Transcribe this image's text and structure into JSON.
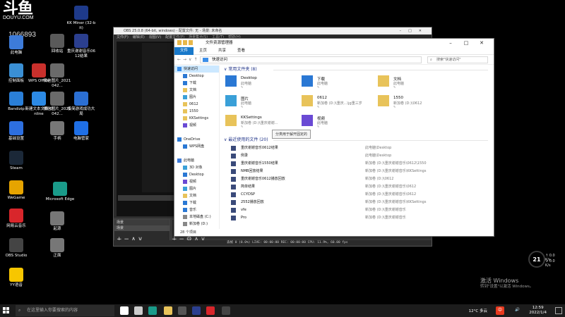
{
  "watermark": {
    "logo": "斗鱼",
    "site": "DOUYU.COM",
    "room": "1066893"
  },
  "desktop_icons": [
    {
      "label": "此电脑",
      "color": "#3d7bd9"
    },
    {
      "label": "控制面板",
      "color": "#3a8fd4"
    },
    {
      "label": "Bandizip",
      "color": "#2a7fd8"
    },
    {
      "label": "基础设置",
      "color": "#2d6fe0"
    },
    {
      "label": "Steam",
      "color": "#1b2838"
    },
    {
      "label": "WeGame",
      "color": "#e6a400"
    },
    {
      "label": "网易云音乐",
      "color": "#d8262b"
    },
    {
      "label": "OBS Studio",
      "color": "#444444"
    },
    {
      "label": "YY语音",
      "color": "#f7c600"
    },
    {
      "label": "WPS Office",
      "color": "#c9302c"
    },
    {
      "label": "新建文本文档 Online",
      "color": "#2c8ae5"
    },
    {
      "label": "回收站",
      "color": "#5a5a5a"
    },
    {
      "label": "Microsoft Edge",
      "color": "#1a9b8a"
    },
    {
      "label": "微信图片_2021042...",
      "color": "#6a6a6a"
    },
    {
      "label": "微信图片_2021042...",
      "color": "#6a6a6a"
    },
    {
      "label": "手柄",
      "color": "#777777"
    },
    {
      "label": "起源",
      "color": "#777777"
    },
    {
      "label": "正面",
      "color": "#777777"
    },
    {
      "label": "KK Miner (32-bit)",
      "color": "#1e3a8a"
    },
    {
      "label": "重庆谢谢音乐0612结果",
      "color": "#2b3f8f"
    },
    {
      "label": "极简游戏成功大局",
      "color": "#2b6fd3"
    },
    {
      "label": "电脑管家",
      "color": "#1f6fe5"
    }
  ],
  "obs": {
    "title": "OBS 25.0.8 (64-bit, windows) - 配置文件: 无 - 场景: 未命名",
    "menu": [
      "文件(F)",
      "编辑(E)",
      "视图(V)",
      "配置文件(P)",
      "场景集合(S)",
      "工具(T)",
      "帮助(H)"
    ],
    "scenes_header": "场景",
    "scene_item": "场景",
    "sources_header": "来源",
    "status": "丢帧 0 (0.0%)    LIVE: 00:00:00    REC: 00:00:00    CPU: 11.9%, 60.00 fps"
  },
  "explorer": {
    "title": "文件资源管理器",
    "ribbon_tabs": [
      "文件",
      "主页",
      "共享",
      "查看"
    ],
    "address": "快速访问",
    "search_placeholder": "搜索\"快速访问\"",
    "nav": [
      {
        "label": "快速访问",
        "sel": true,
        "color": "#3b8ee8"
      },
      {
        "label": "Desktop",
        "color": "#2a78d4"
      },
      {
        "label": "下载",
        "color": "#2a78d4"
      },
      {
        "label": "文档",
        "color": "#e8c35a"
      },
      {
        "label": "图片",
        "color": "#3aa0d8"
      },
      {
        "label": "0612",
        "color": "#e8c35a"
      },
      {
        "label": "1550",
        "color": "#e8c35a"
      },
      {
        "label": "KKSettings",
        "color": "#e8c35a"
      },
      {
        "label": "视频",
        "color": "#6a4ad4"
      },
      {
        "label": "",
        "color": "transparent"
      },
      {
        "label": "OneDrive",
        "color": "#2a78d4"
      },
      {
        "label": "WPS网盘",
        "color": "#2a78d4"
      },
      {
        "label": "",
        "color": "transparent"
      },
      {
        "label": "此电脑",
        "color": "#3d7bd9"
      },
      {
        "label": "3D 对象",
        "color": "#3aa0d8"
      },
      {
        "label": "Desktop",
        "color": "#2a78d4"
      },
      {
        "label": "视频",
        "color": "#6a4ad4"
      },
      {
        "label": "图片",
        "color": "#3aa0d8"
      },
      {
        "label": "文档",
        "color": "#e8c35a"
      },
      {
        "label": "下载",
        "color": "#2a78d4"
      },
      {
        "label": "音乐",
        "color": "#2a78d4"
      },
      {
        "label": "本地磁盘 (C:)",
        "color": "#888888"
      },
      {
        "label": "新加卷 (D:)",
        "color": "#888888"
      }
    ],
    "frequent_header": "常用文件夹 (8)",
    "frequent": [
      {
        "name": "Desktop",
        "loc": "此电脑",
        "color": "#2a78d4"
      },
      {
        "name": "下载",
        "loc": "此电脑",
        "color": "#2a78d4"
      },
      {
        "name": "文档",
        "loc": "此电脑",
        "color": "#e8c35a"
      },
      {
        "name": "图片",
        "loc": "此电脑",
        "color": "#3aa0d8"
      },
      {
        "name": "0612",
        "loc": "新加卷 (D:)\\重庆...\\jg重三岁",
        "color": "#e8c35a"
      },
      {
        "name": "1550",
        "loc": "新加卷 (D:)\\0612",
        "color": "#e8c35a"
      },
      {
        "name": "KKSettings",
        "loc": "新加卷 (D:)\\重庆谢谢...",
        "color": "#e8c35a"
      },
      {
        "name": "视频",
        "loc": "此电脑",
        "color": "#6a4ad4"
      }
    ],
    "tooltip": "分类用于解开固定的",
    "recent_header": "最近使用的文件 (20)",
    "recent": [
      {
        "name": "重庆谢谢音乐0612结果",
        "path": "此电脑\\Desktop"
      },
      {
        "name": "例录",
        "path": "此电脑\\Desktop"
      },
      {
        "name": "重庆谢谢音乐1550结果",
        "path": "新加卷 (D:)\\重庆谢谢音乐\\0612\\1550"
      },
      {
        "name": "NMB回放结果",
        "path": "新加卷 (D:)\\重庆谢谢音乐\\KKSettings"
      },
      {
        "name": "重庆谢谢音乐0612播放回放",
        "path": "新加卷 (D:)\\0612"
      },
      {
        "name": "简单结果",
        "path": "新加卷 (D:)\\重庆谢谢音乐\\0612"
      },
      {
        "name": "CCYDSP",
        "path": "新加卷 (D:)\\重庆谢谢音乐\\0612"
      },
      {
        "name": "2552播放回放",
        "path": "新加卷 (D:)\\重庆谢谢音乐\\KKSettings"
      },
      {
        "name": "vfe",
        "path": "新加卷 (D:)\\重庆谢谢音乐"
      },
      {
        "name": "Pro",
        "path": "新加卷 (D:)\\重庆谢谢音乐"
      }
    ],
    "status": "28 个项目"
  },
  "weather_widget": {
    "value": "21",
    "up": "↑ 0.0 K/s",
    "down": "↓ 0.0 K/s"
  },
  "activation": {
    "line1": "激活 Windows",
    "line2": "转到\"设置\"以激活 Windows。"
  },
  "taskbar": {
    "search_placeholder": "在这里输入你要搜索的内容",
    "apps": [
      {
        "name": "cortana",
        "color": "#ffffff"
      },
      {
        "name": "task-view",
        "color": "#cccccc"
      },
      {
        "name": "edge",
        "color": "#1a9b8a"
      },
      {
        "name": "explorer",
        "color": "#e8c35a"
      },
      {
        "name": "obs",
        "color": "#555555"
      },
      {
        "name": "kx-app",
        "color": "#2b3f8f"
      },
      {
        "name": "netease",
        "color": "#d8262b"
      },
      {
        "name": "obs2",
        "color": "#444444"
      }
    ],
    "weather": "12°C 多云",
    "ime": "中",
    "time": "12:59",
    "date": "2022/1/4"
  }
}
